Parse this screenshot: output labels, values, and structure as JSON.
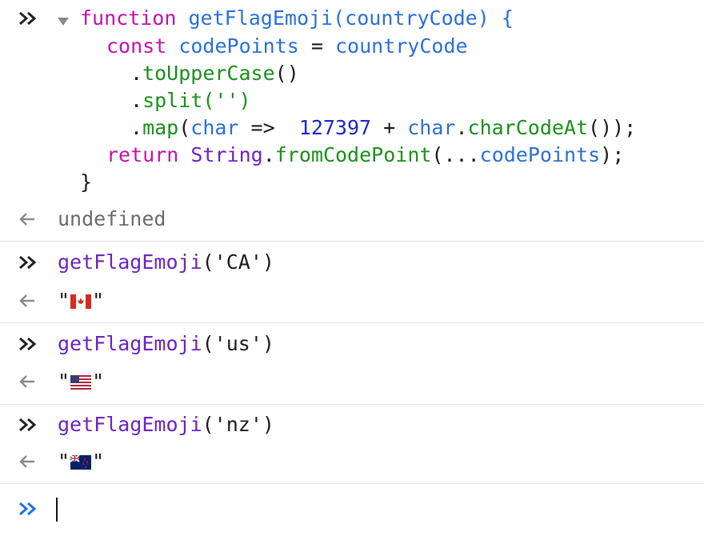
{
  "code": {
    "l1_kw": "function",
    "l1_name": "getFlagEmoji",
    "l1_param": "(countryCode) {",
    "l2_kw": "const",
    "l2_var": "codePoints",
    "l2_eq": " = ",
    "l2_val": "countryCode",
    "l3_dot": ".",
    "l3_method": "toUpperCase",
    "l3_rest": "()",
    "l4_dot": ".",
    "l4_method": "split",
    "l4_rest": "('')",
    "l5_dot": ".",
    "l5_method": "map",
    "l5_open": "(",
    "l5_arg": "char",
    "l5_arrow": " =>  ",
    "l5_num": "127397",
    "l5_plus": " + ",
    "l5_char": "char",
    "l5_dot2": ".",
    "l5_method2": "charCodeAt",
    "l5_end": "());",
    "l6_kw": "return",
    "l6_obj": "String",
    "l6_dot": ".",
    "l6_method": "fromCodePoint",
    "l6_open": "(...",
    "l6_var": "codePoints",
    "l6_end": ");",
    "l7": "}"
  },
  "result_undefined": "undefined",
  "entries": [
    {
      "call_name": "getFlagEmoji",
      "call_arg": "('CA')",
      "quote": "\"",
      "flag": "canada-flag"
    },
    {
      "call_name": "getFlagEmoji",
      "call_arg": "('us')",
      "quote": "\"",
      "flag": "usa-flag"
    },
    {
      "call_name": "getFlagEmoji",
      "call_arg": "('nz')",
      "quote": "\"",
      "flag": "nz-flag"
    }
  ],
  "colors": {
    "keyword": "#c312aa",
    "function_name": "#2a6fd6",
    "method": "#1b8f1b",
    "number": "#1f27c9",
    "call": "#6b24c0",
    "prompt_active": "#1a73e8"
  }
}
